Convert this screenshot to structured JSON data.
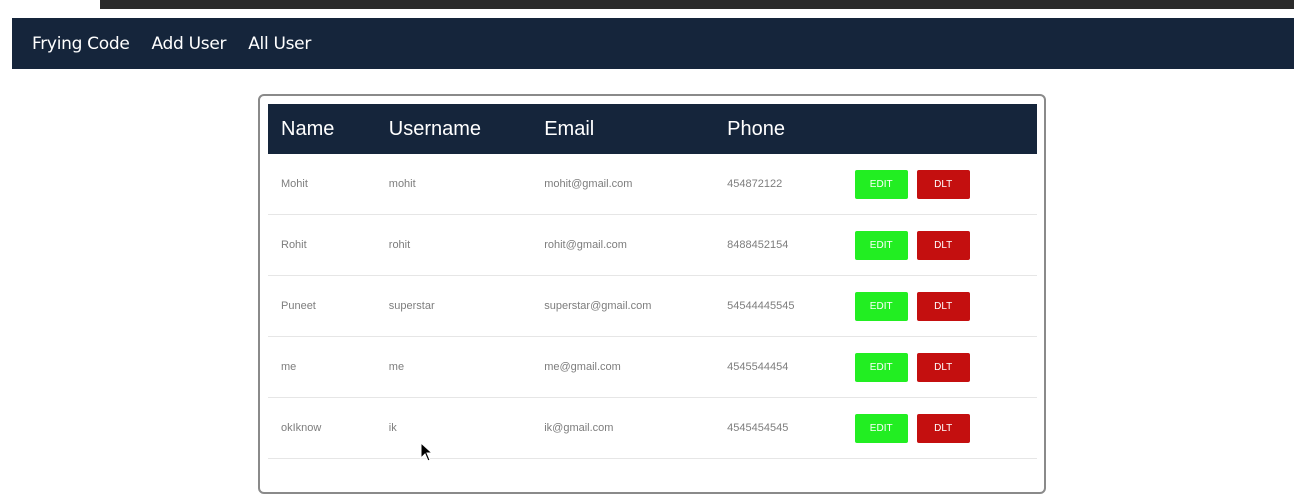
{
  "navbar": {
    "links": [
      {
        "label": "Frying Code"
      },
      {
        "label": "Add User"
      },
      {
        "label": "All User"
      }
    ]
  },
  "table": {
    "headers": [
      "Name",
      "Username",
      "Email",
      "Phone",
      ""
    ],
    "rows": [
      {
        "name": "Mohit",
        "username": "mohit",
        "email": "mohit@gmail.com",
        "phone": "454872122",
        "edit": "EDIT",
        "delete": "DLT"
      },
      {
        "name": "Rohit",
        "username": "rohit",
        "email": "rohit@gmail.com",
        "phone": "8488452154",
        "edit": "EDIT",
        "delete": "DLT"
      },
      {
        "name": "Puneet",
        "username": "superstar",
        "email": "superstar@gmail.com",
        "phone": "54544445545",
        "edit": "EDIT",
        "delete": "DLT"
      },
      {
        "name": "me",
        "username": "me",
        "email": "me@gmail.com",
        "phone": "4545544454",
        "edit": "EDIT",
        "delete": "DLT"
      },
      {
        "name": "okIknow",
        "username": "ik",
        "email": "ik@gmail.com",
        "phone": "4545454545",
        "edit": "EDIT",
        "delete": "DLT"
      }
    ]
  },
  "colors": {
    "navbar_bg": "#15253b",
    "edit_button": "#22ee22",
    "delete_button": "#c40f0f"
  },
  "icons": {
    "cursor": "mouse-pointer-icon"
  }
}
